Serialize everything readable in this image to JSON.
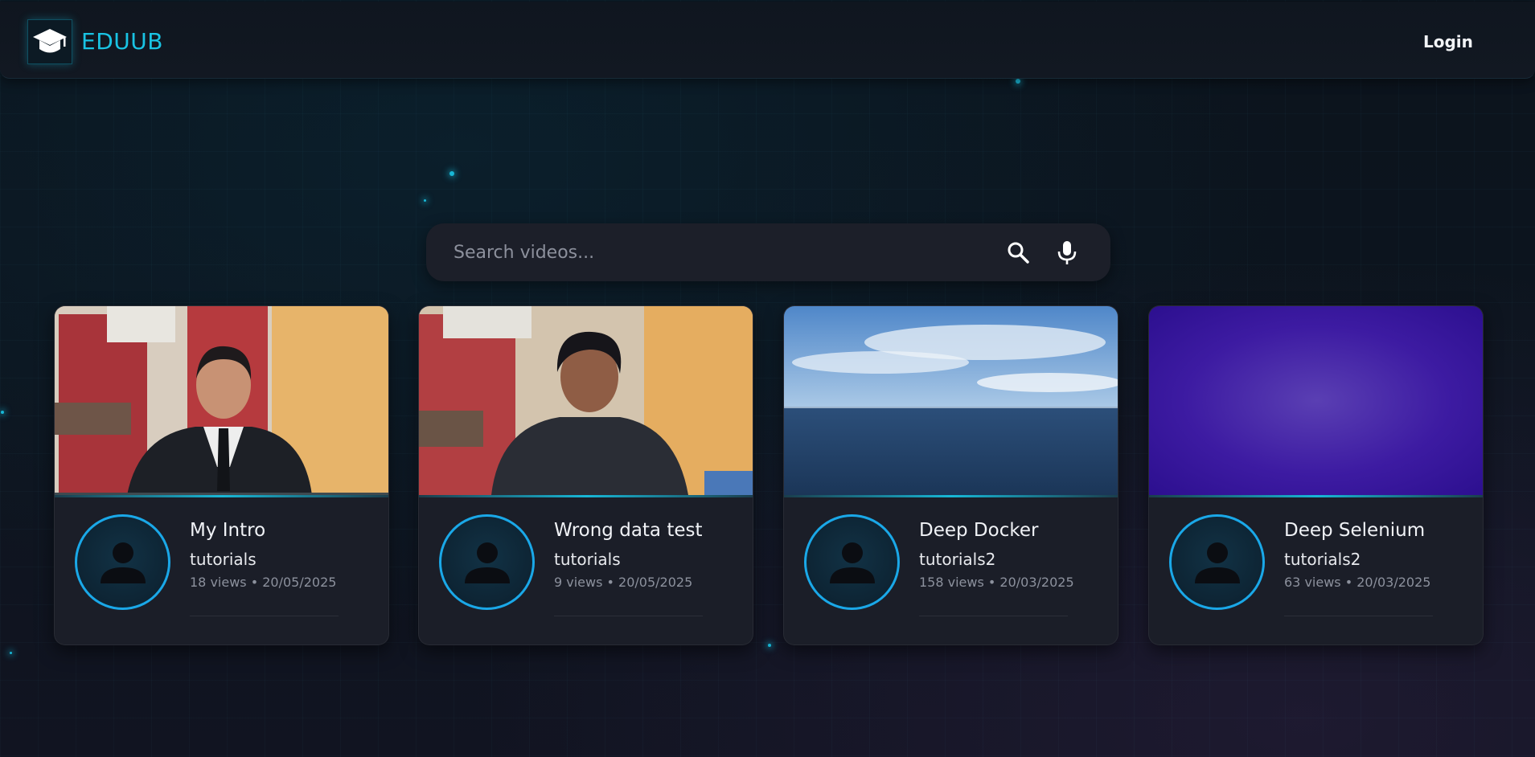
{
  "header": {
    "brand": "EDUUB",
    "login_label": "Login",
    "logo_icon": "graduation-cap-icon",
    "accent_color": "#19c3e3"
  },
  "search": {
    "placeholder": "Search videos...",
    "value": "",
    "search_icon": "search-icon",
    "mic_icon": "microphone-icon"
  },
  "videos": [
    {
      "title": "My Intro",
      "channel": "tutorials",
      "meta": "18 views • 20/05/2025",
      "thumbnail": "person-in-suit"
    },
    {
      "title": "Wrong data test",
      "channel": "tutorials",
      "meta": "9 views • 20/05/2025",
      "thumbnail": "person-in-shirt"
    },
    {
      "title": "Deep Docker",
      "channel": "tutorials2",
      "meta": "158 views • 20/03/2025",
      "thumbnail": "ocean-sky"
    },
    {
      "title": "Deep Selenium",
      "channel": "tutorials2",
      "meta": "63 views • 20/03/2025",
      "thumbnail": "purple-gradient"
    }
  ],
  "colors": {
    "avatar_ring": "#1aa8e8",
    "card_bg": "#1b1e28",
    "page_bg": "#0d151f"
  }
}
